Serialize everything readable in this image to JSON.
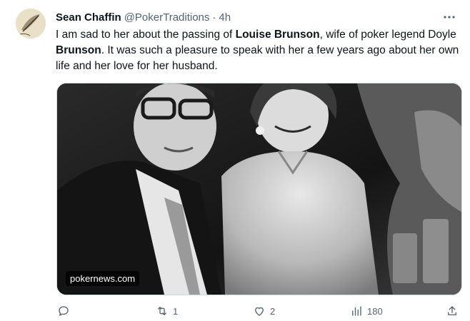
{
  "tweet": {
    "author_name": "Sean Chaffin",
    "author_handle": "@PokerTraditions",
    "separator": "·",
    "time": "4h",
    "text": {
      "part1": "I am sad to her about the passing of ",
      "bold1": "Louise Brunson",
      "part2": ", wife of poker legend Doyle ",
      "bold2": "Brunson",
      "part3": ". It was such a pleasure to speak with her a few years ago about her own life and her love for her husband."
    },
    "media": {
      "source_label": "pokernews.com"
    },
    "actions": {
      "reply_count": "",
      "retweet_count": "1",
      "like_count": "2",
      "views_count": "180"
    }
  },
  "icons": {
    "more": "more-icon",
    "reply": "reply-icon",
    "retweet": "retweet-icon",
    "like": "heart-icon",
    "views": "views-icon",
    "share": "share-icon"
  }
}
